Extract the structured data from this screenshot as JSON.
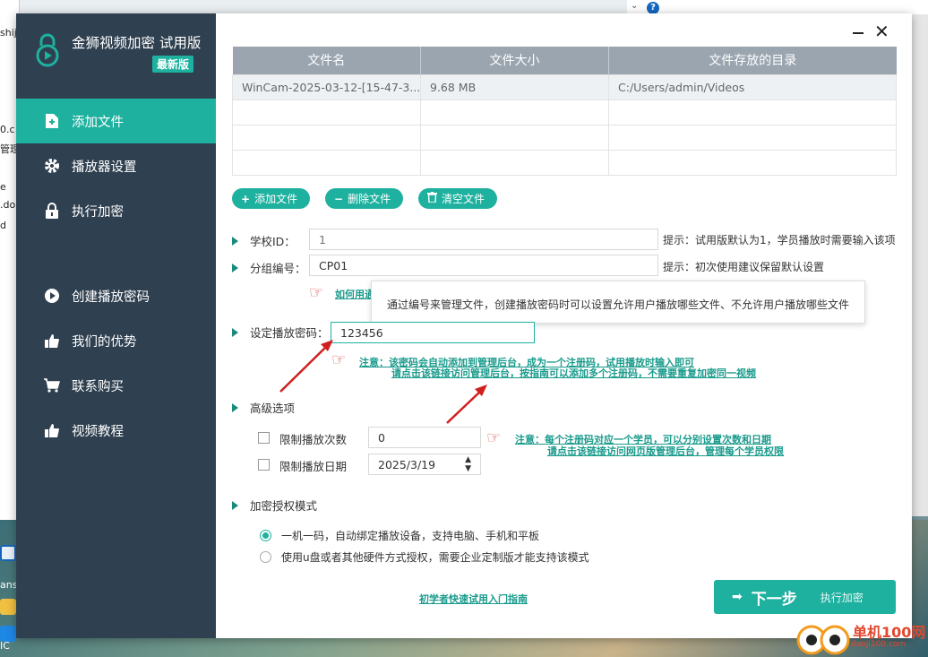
{
  "background": {
    "left_snippets": [
      "shij",
      "0.c",
      "管理",
      "e",
      ".do",
      "d",
      "ans",
      "IC"
    ],
    "help_label": "?"
  },
  "app": {
    "name": "金狮视频加密 试用版",
    "edition_badge": "最新版",
    "close_label": "✕"
  },
  "sidebar": {
    "items": [
      {
        "label": "添加文件",
        "icon": "add-file-icon",
        "active": true
      },
      {
        "label": "播放器设置",
        "icon": "gear-icon",
        "active": false
      },
      {
        "label": "执行加密",
        "icon": "lock-icon",
        "active": false
      },
      {
        "label": "创建播放密码",
        "icon": "play-circle-icon",
        "active": false
      },
      {
        "label": "我们的优势",
        "icon": "thumbs-up-icon",
        "active": false
      },
      {
        "label": "联系购买",
        "icon": "cart-icon",
        "active": false
      },
      {
        "label": "视频教程",
        "icon": "thumbs-up-icon",
        "active": false
      }
    ]
  },
  "file_table": {
    "headers": [
      "文件名",
      "文件大小",
      "文件存放的目录"
    ],
    "rows": [
      [
        "WinCam-2025-03-12-[15-47-3...",
        "9.68 MB",
        "C:/Users/admin/Videos"
      ],
      [
        "",
        "",
        ""
      ],
      [
        "",
        "",
        ""
      ],
      [
        "",
        "",
        ""
      ]
    ]
  },
  "actions": {
    "add_file": "添加文件",
    "delete_file": "删除文件",
    "clear_files": "清空文件"
  },
  "form": {
    "school_id": {
      "label": "学校ID：",
      "placeholder": "1",
      "hint": "提示：试用版默认为1，学员播放时需要输入该项"
    },
    "group_no": {
      "label": "分组编号：",
      "value": "CP01",
      "hint": "提示：初次使用建议保留默认设置"
    },
    "group_link": "如何用通",
    "tooltip": "通过编号来管理文件，创建播放密码时可以设置允许用户播放哪些文件、不允许用户播放哪些文件",
    "password": {
      "label": "设定播放密码：",
      "value": "123456",
      "note_line1": "注意：该密码会自动添加到管理后台，成为一个注册码，试用播放时输入即可",
      "note_line2": "请点击该链接访问管理后台，按指南可以添加多个注册码，不需要重复加密同一视频"
    },
    "advanced": {
      "label": "高级选项",
      "limit_count_label": "限制播放次数",
      "limit_count_value": "0",
      "limit_date_label": "限制播放日期",
      "limit_date_value": "2025/3/19",
      "note_line1": "注意：每个注册码对应一个学员，可以分别设置次数和日期",
      "note_line2": "请点击该链接访问网页版管理后台，管理每个学员权限"
    },
    "auth_mode": {
      "label": "加密授权模式",
      "option1": "一机一码，自动绑定播放设备，支持电脑、手机和平板",
      "option2": "使用u盘或者其他硬件方式授权，需要企业定制版才能支持该模式",
      "selected": 1
    }
  },
  "footer": {
    "guide_link": "初学者快速试用入门指南",
    "next_label": "下一步",
    "next_sub": "执行加密"
  },
  "watermark": {
    "text": "单机100网",
    "sub": "danji100.com"
  },
  "colors": {
    "accent": "#1eb19f",
    "sidebar_bg": "#2f4050",
    "table_header": "#9aa5b0",
    "note_red": "#d9534f"
  }
}
